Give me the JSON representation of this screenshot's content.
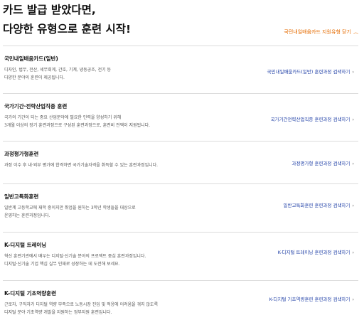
{
  "header": {
    "title_line1": "카드 발급 받았다면,",
    "title_line2": "다양한 유형으로 훈련 시작!",
    "toggle_label": "국민내일배움카드 지원유형 닫기",
    "toggle_icon": "chevron-up-icon",
    "accent_color": "#e56b00",
    "link_color": "#1f3fa6"
  },
  "programs": [
    {
      "name": "국민내일배움카드(일반)",
      "desc": [
        "디자인, 법무, 전산, 세무회계, 간호, 기계, 냉동공조, 전기 등",
        "다양한 분야의 훈련이 제공됩니다."
      ],
      "link": "국민내일배움카드(일반) 훈련과정 검색하기"
    },
    {
      "name": "국가기간·전략산업직종 훈련",
      "desc": [
        "국가의 기간이 되는 중요 산업분야에 필요한 인력을 양성하기 위해",
        "3개월 이상의 장기 훈련과정으로 구성된 훈련과정으로, 훈련비 전액이 지원됩니다."
      ],
      "link": "국가기간전략산업직종 훈련과정 검색하기"
    },
    {
      "name": "과정평가형훈련",
      "desc": [
        "과정 이수 후 내·외부 평가에 합격하면 국가기술자격을 취득할 수 있는 훈련과정입니다."
      ],
      "link": "과정평가형 훈련과정 검색하기"
    },
    {
      "name": "일반고특화훈련",
      "desc": [
        "일반계 고등학교에 재학 중이지만 취업을 원하는 3학년 학생들을 대상으로",
        "운영하는 훈련과정입니다."
      ],
      "link": "일반고특화훈련 훈련과정 검색하기"
    },
    {
      "name": "K-디지털 트레이닝",
      "desc": [
        "혁신 훈련기관에서 배우는 디지털·신기술 분야의 프로젝트 중심 훈련과정입니다.",
        "디지털·신기술 기업 핵심 실무 인재로 성장하는 데 도전해 보세요."
      ],
      "link": "K-디지털 트레이닝 훈련과정 검색하기"
    },
    {
      "name": "K-디지털 기초역량훈련",
      "desc": [
        "근로자, 구직자가 디지털 역량 부족으로 노동시장 진입 및 적응에 어려움을 겪지 않도록",
        "디지털 분야 기초역량 개발을 지원하는 정부지원 훈련입니다."
      ],
      "link": "K-디지털 기초역량훈련 훈련과정 검색하기"
    }
  ]
}
